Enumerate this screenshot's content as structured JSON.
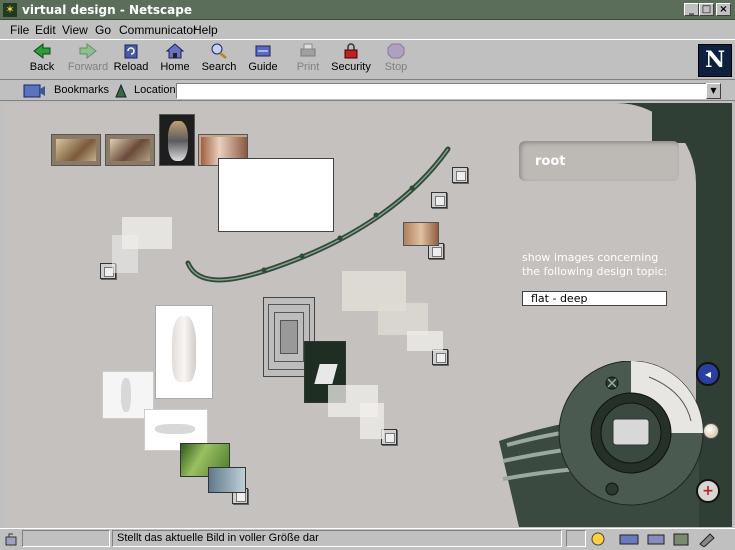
{
  "window": {
    "title": "virtual design - Netscape",
    "controls": {
      "minimize": "_",
      "maximize": "□",
      "close": "×"
    }
  },
  "menu": [
    "File",
    "Edit",
    "View",
    "Go",
    "Communicator",
    "Help"
  ],
  "toolbar": {
    "buttons": [
      {
        "label": "Back",
        "icon": "back-arrow-icon",
        "enabled": true
      },
      {
        "label": "Forward",
        "icon": "forward-arrow-icon",
        "enabled": false
      },
      {
        "label": "Reload",
        "icon": "reload-icon",
        "enabled": true
      },
      {
        "label": "Home",
        "icon": "home-icon",
        "enabled": true
      },
      {
        "label": "Search",
        "icon": "search-icon",
        "enabled": true
      },
      {
        "label": "Guide",
        "icon": "guide-icon",
        "enabled": true
      },
      {
        "label": "Print",
        "icon": "print-icon",
        "enabled": false
      },
      {
        "label": "Security",
        "icon": "security-lock-icon",
        "enabled": true
      },
      {
        "label": "Stop",
        "icon": "stop-icon",
        "enabled": false
      }
    ],
    "logo": "N"
  },
  "location": {
    "bookmarks_label": "Bookmarks",
    "location_label": "Location:",
    "url": ""
  },
  "content": {
    "root_label": "root",
    "topic_prompt_line1": "show images concerning",
    "topic_prompt_line2": "the following design topic:",
    "topic_value": "flat - deep"
  },
  "status": {
    "text": "Stellt das aktuelle Bild in voller Größe dar"
  },
  "colors": {
    "titlebar": "#5a6e5a",
    "chrome": "#c0c0c0",
    "content_bg": "#c4c1be",
    "panel_dark": "#2f3f36",
    "accent_blue": "#2a3fa0",
    "accent_red": "#c02020"
  }
}
